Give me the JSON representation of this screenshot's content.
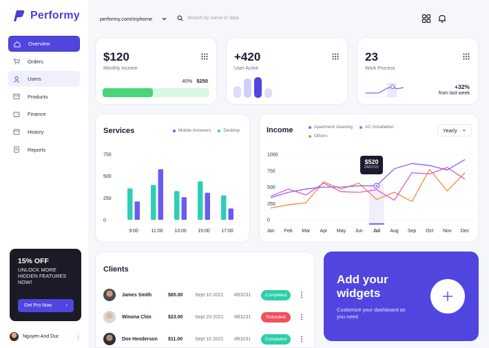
{
  "brand": {
    "name": "Performy",
    "color": "#5145e0"
  },
  "sidebar": {
    "items": [
      {
        "label": "Overview",
        "icon": "home-icon",
        "active": true
      },
      {
        "label": "Orders",
        "icon": "cart-icon"
      },
      {
        "label": "Users",
        "icon": "user-icon"
      },
      {
        "label": "Products",
        "icon": "box-icon"
      },
      {
        "label": "Finance",
        "icon": "wallet-icon"
      },
      {
        "label": "History",
        "icon": "calendar-icon"
      },
      {
        "label": "Reports",
        "icon": "document-icon"
      }
    ],
    "promo": {
      "title": "15% OFF",
      "subtitle": "UNLOCK MORE HIDDEN FEATURES NOW!",
      "button": "Get Pro Now"
    },
    "user": {
      "name": "Nguyen And Duc"
    }
  },
  "header": {
    "url": "performy.com/myhome",
    "search_placeholder": "Search by name or data"
  },
  "kpis": {
    "income": {
      "value": "$120",
      "label": "Monthly Income",
      "percent_label": "40%",
      "target": "$250",
      "progress": 0.47
    },
    "users": {
      "value": "+420",
      "label": "User Active"
    },
    "work": {
      "value": "23",
      "label": "Work Process",
      "change": "+32%",
      "change_label": "from last week"
    }
  },
  "services": {
    "title": "Services",
    "legend": [
      "Mobile browsers",
      "Desktop"
    ]
  },
  "income": {
    "title": "Income",
    "legend": [
      "Apartment cleaning",
      "AC Installation",
      "Others"
    ],
    "period": "Yearly",
    "tooltip": {
      "value": "$520",
      "date": "24/07/21"
    }
  },
  "clients": {
    "title": "Clients",
    "rows": [
      {
        "name": "James Smith",
        "amount": "$65.00",
        "date": "Sept 10 2021",
        "code": "#B3231",
        "status": "Completed",
        "status_color": "#2ccfa8"
      },
      {
        "name": "Winona Chin",
        "amount": "$23.00",
        "date": "Sept 23 2021",
        "code": "#B3231",
        "status": "Refunded",
        "status_color": "#f0505c"
      },
      {
        "name": "Doe Henderson",
        "amount": "$11.00",
        "date": "Sept 10 2021",
        "code": "#B3231",
        "status": "Completed",
        "status_color": "#2ccfa8"
      }
    ]
  },
  "widget": {
    "title": "Add your widgets",
    "subtitle": "Customize your dashboard as you need"
  },
  "chart_data": [
    {
      "type": "bar",
      "categories": [
        "9:00",
        "11:00",
        "13:00",
        "15:00",
        "17:00"
      ],
      "series": [
        {
          "name": "Mobile browsers",
          "color": "#6a5cf0",
          "values": [
            210,
            580,
            260,
            310,
            130
          ]
        },
        {
          "name": "Desktop",
          "color": "#2ccfb4",
          "values": [
            360,
            400,
            330,
            440,
            280
          ]
        }
      ],
      "yticks": [
        0,
        250,
        500,
        750
      ],
      "ylim": [
        0,
        750
      ]
    },
    {
      "type": "line",
      "categories": [
        "Jan",
        "Feb",
        "Mar",
        "Apr",
        "May",
        "Jun",
        "Jul",
        "Aug",
        "Sep",
        "Oct",
        "Nov",
        "Dec"
      ],
      "series": [
        {
          "name": "Apartment cleaning",
          "color": "#8b5cf6",
          "values": [
            340,
            420,
            470,
            500,
            500,
            520,
            520,
            780,
            860,
            830,
            760,
            920
          ]
        },
        {
          "name": "AC Installation",
          "color": "#d85ad8",
          "values": [
            360,
            470,
            380,
            560,
            430,
            420,
            460,
            300,
            720,
            700,
            800,
            620
          ]
        },
        {
          "name": "Others",
          "color": "#f58a3a",
          "values": [
            180,
            230,
            260,
            580,
            470,
            560,
            310,
            420,
            280,
            770,
            440,
            720
          ]
        }
      ],
      "yticks": [
        0,
        250,
        500,
        750,
        1000
      ],
      "ylim": [
        0,
        1000
      ]
    }
  ]
}
